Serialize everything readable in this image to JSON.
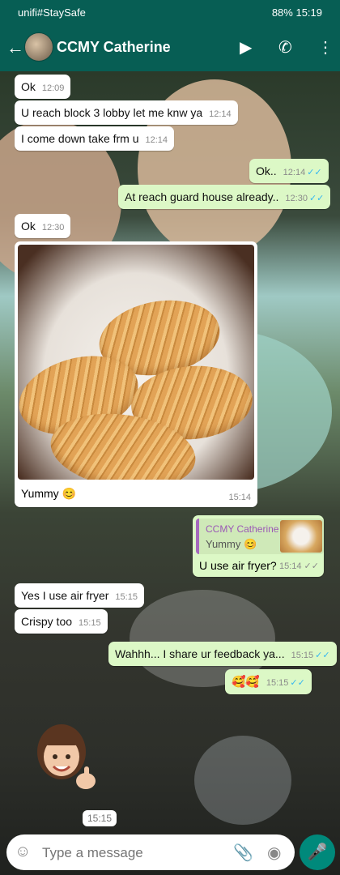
{
  "status": {
    "left": "unifi#StaySafe",
    "right": "88%  15:19"
  },
  "header": {
    "title": "CCMY Catherine"
  },
  "messages": [
    {
      "text": "Ok",
      "time": "12:09"
    },
    {
      "text": "U reach block 3 lobby let me knw ya",
      "time": "12:14"
    },
    {
      "text": "I come down take frm u",
      "time": "12:14"
    },
    {
      "text": "Ok..",
      "time": "12:14"
    },
    {
      "text": "At reach guard house already..",
      "time": "12:30"
    },
    {
      "text": "Ok",
      "time": "12:30"
    },
    {
      "text": "Yes I use air fryer",
      "time": "15:15"
    },
    {
      "text": "Crispy too",
      "time": "15:15"
    },
    {
      "text": "Wahhh... I share ur feedback ya...",
      "time": "15:15"
    },
    {
      "text": "🥰🥰",
      "time": "15:15"
    }
  ],
  "photo": {
    "caption": "Yummy 😊",
    "time": "15:14"
  },
  "reply": {
    "quote_name": "CCMY Catherine",
    "quote_text": "Yummy 😊",
    "text": "U use air fryer?",
    "time": "15:14"
  },
  "sticker_time": "15:15",
  "composer": {
    "placeholder": "Type a message"
  },
  "colors": {
    "header": "#075e54",
    "outgoing": "#dcf8c6",
    "incoming": "#ffffff",
    "mic": "#00897b"
  },
  "icons": [
    "back-arrow-icon",
    "video-call-icon",
    "phone-icon",
    "more-vert-icon",
    "emoji-icon",
    "attach-icon",
    "camera-icon",
    "mic-icon"
  ]
}
